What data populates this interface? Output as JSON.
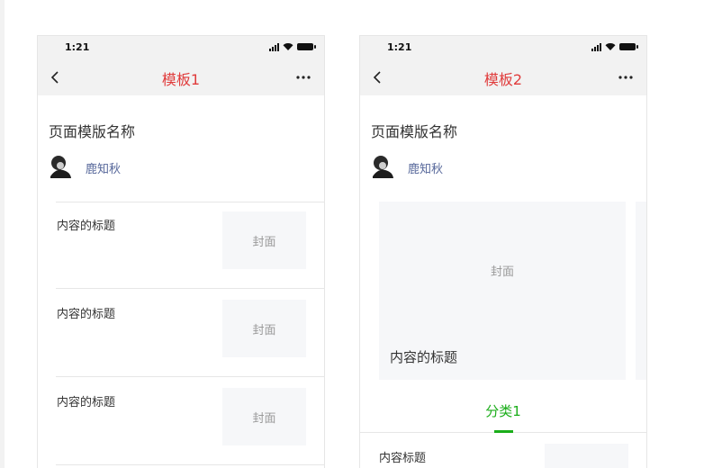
{
  "template1": {
    "status_time": "1:21",
    "nav_title": "模板1",
    "doc_title": "页面模版名称",
    "author_name": "鹿知秋",
    "items": [
      {
        "title": "内容的标题",
        "cover": "封面"
      },
      {
        "title": "内容的标题",
        "cover": "封面"
      },
      {
        "title": "内容的标题",
        "cover": "封面"
      }
    ]
  },
  "template2": {
    "status_time": "1:21",
    "nav_title": "模板2",
    "doc_title": "页面模版名称",
    "author_name": "鹿知秋",
    "card": {
      "cover": "封面",
      "title": "内容的标题"
    },
    "tab_label": "分类1",
    "list_item_title": "内容标题"
  },
  "colors": {
    "nav_title": "#e03b3b",
    "tab_active": "#1aad19",
    "author_link": "#56679a"
  },
  "icons": [
    "back-arrow-icon",
    "more-icon",
    "signal-icon",
    "wifi-icon",
    "battery-icon"
  ]
}
